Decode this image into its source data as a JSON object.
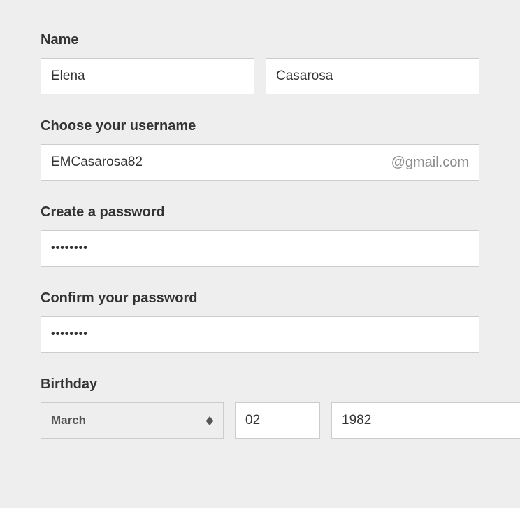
{
  "name": {
    "label": "Name",
    "first_value": "Elena",
    "last_value": "Casarosa"
  },
  "username": {
    "label": "Choose your username",
    "value": "EMCasarosa82",
    "suffix": "@gmail.com"
  },
  "password": {
    "label": "Create a password",
    "masked": "••••••••"
  },
  "confirm_password": {
    "label": "Confirm your password",
    "masked": "••••••••"
  },
  "birthday": {
    "label": "Birthday",
    "month": "March",
    "day": "02",
    "year": "1982"
  }
}
